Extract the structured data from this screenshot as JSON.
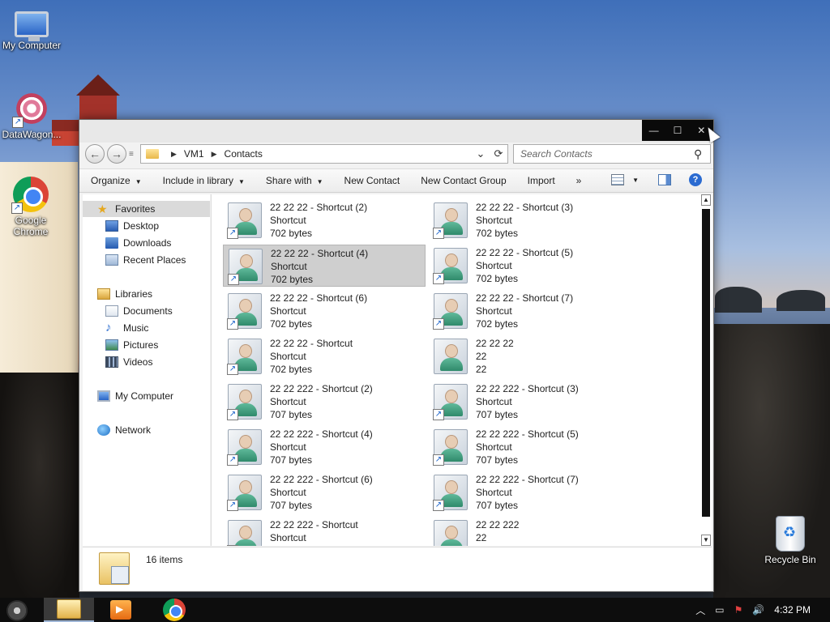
{
  "desktop": {
    "icons": [
      {
        "label": "My Computer"
      },
      {
        "label": "DataWagon..."
      },
      {
        "label": "Google Chrome"
      },
      {
        "label": "Recycle Bin"
      }
    ]
  },
  "window": {
    "caption_buttons": {
      "minimize": "—",
      "maximize": "☐",
      "close": "✕"
    },
    "address": {
      "segments": [
        "VM1",
        "Contacts"
      ],
      "separator": "▶",
      "dropdown_glyph": "⌄",
      "refresh_glyph": "⟳"
    },
    "search": {
      "placeholder": "Search Contacts",
      "icon_glyph": "⚲"
    },
    "nav_buttons": {
      "back": "←",
      "forward": "→",
      "recent": "≡"
    },
    "toolbar": {
      "organize": "Organize",
      "include_in_library": "Include in library",
      "share_with": "Share with",
      "new_contact": "New Contact",
      "new_contact_group": "New Contact Group",
      "import": "Import",
      "more": "»",
      "caret": "▼",
      "help": "?"
    },
    "nav_pane": {
      "favorites": "Favorites",
      "desktop": "Desktop",
      "downloads": "Downloads",
      "recent_places": "Recent Places",
      "libraries": "Libraries",
      "documents": "Documents",
      "music": "Music",
      "pictures": "Pictures",
      "videos": "Videos",
      "my_computer": "My Computer",
      "network": "Network"
    },
    "files": [
      {
        "name": "22 22 22 - Shortcut (2)",
        "type": "Shortcut",
        "size": "702 bytes"
      },
      {
        "name": "22 22 22 - Shortcut (3)",
        "type": "Shortcut",
        "size": "702 bytes"
      },
      {
        "name": "22 22 22 - Shortcut (4)",
        "type": "Shortcut",
        "size": "702 bytes"
      },
      {
        "name": "22 22 22 - Shortcut (5)",
        "type": "Shortcut",
        "size": "702 bytes"
      },
      {
        "name": "22 22 22 - Shortcut (6)",
        "type": "Shortcut",
        "size": "702 bytes"
      },
      {
        "name": "22 22 22 - Shortcut (7)",
        "type": "Shortcut",
        "size": "702 bytes"
      },
      {
        "name": "22 22 22 - Shortcut",
        "type": "Shortcut",
        "size": "702 bytes"
      },
      {
        "name": "22 22 22",
        "type": "22",
        "size": "22"
      },
      {
        "name": "22 22 222 - Shortcut (2)",
        "type": "Shortcut",
        "size": "707 bytes"
      },
      {
        "name": "22 22 222 - Shortcut (3)",
        "type": "Shortcut",
        "size": "707 bytes"
      },
      {
        "name": "22 22 222 - Shortcut (4)",
        "type": "Shortcut",
        "size": "707 bytes"
      },
      {
        "name": "22 22 222 - Shortcut (5)",
        "type": "Shortcut",
        "size": "707 bytes"
      },
      {
        "name": "22 22 222 - Shortcut (6)",
        "type": "Shortcut",
        "size": "707 bytes"
      },
      {
        "name": "22 22 222 - Shortcut (7)",
        "type": "Shortcut",
        "size": "707 bytes"
      },
      {
        "name": "22 22 222 - Shortcut",
        "type": "Shortcut",
        "size": ""
      },
      {
        "name": "22 22 222",
        "type": "22",
        "size": ""
      }
    ],
    "selected_file": "22 22 22 - Shortcut (4)",
    "details": {
      "count": "16 items"
    },
    "scroll": {
      "up": "▲",
      "down": "▼"
    }
  },
  "taskbar": {
    "tray": {
      "chevron": "︿",
      "clock": "4:32 PM",
      "volume": "🔊",
      "flag": "⚑",
      "network": "▭"
    }
  }
}
